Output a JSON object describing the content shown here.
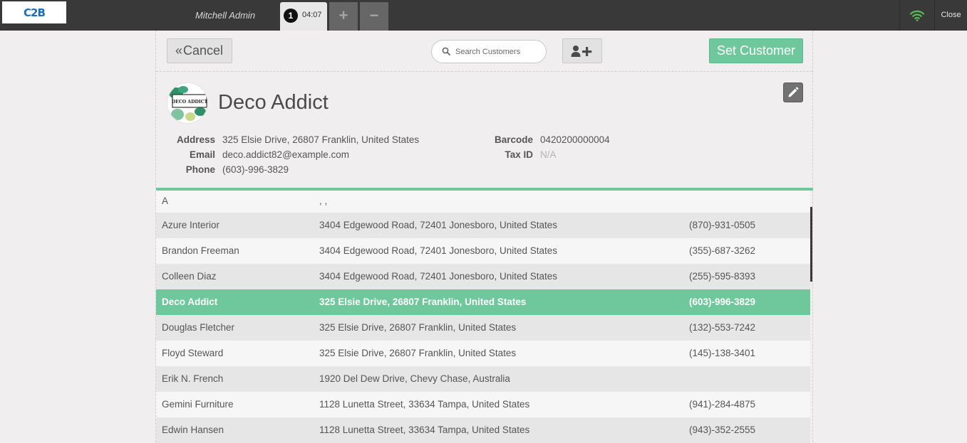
{
  "topbar": {
    "logo_text": "C2B",
    "user_name": "Mitchell Admin",
    "order_number": "1",
    "order_time": "04:07",
    "add_label": "+",
    "remove_label": "−",
    "close_label": "Close",
    "wifi_color": "#5cb85c"
  },
  "controls": {
    "cancel_chevron": "«",
    "cancel_label": "Cancel",
    "search_placeholder": "Search Customers",
    "set_customer_label": "Set Customer"
  },
  "customer": {
    "name": "Deco Addict",
    "logo_text": "DECO ADDICT",
    "address_label": "Address",
    "address": "325 Elsie Drive, 26807 Franklin, United States",
    "email_label": "Email",
    "email": "deco.addict82@example.com",
    "phone_label": "Phone",
    "phone": "(603)-996-3829",
    "barcode_label": "Barcode",
    "barcode": "0420200000004",
    "taxid_label": "Tax ID",
    "taxid": "N/A"
  },
  "list": {
    "rows": [
      {
        "name": "A",
        "address": ", ,",
        "phone": ""
      },
      {
        "name": "Azure Interior",
        "address": "3404 Edgewood Road, 72401 Jonesboro, United States",
        "phone": "(870)-931-0505"
      },
      {
        "name": "Brandon Freeman",
        "address": "3404 Edgewood Road, 72401 Jonesboro, United States",
        "phone": "(355)-687-3262"
      },
      {
        "name": "Colleen Diaz",
        "address": "3404 Edgewood Road, 72401 Jonesboro, United States",
        "phone": "(255)-595-8393"
      },
      {
        "name": "Deco Addict",
        "address": "325 Elsie Drive, 26807 Franklin, United States",
        "phone": "(603)-996-3829"
      },
      {
        "name": "Douglas Fletcher",
        "address": "325 Elsie Drive, 26807 Franklin, United States",
        "phone": "(132)-553-7242"
      },
      {
        "name": "Floyd Steward",
        "address": "325 Elsie Drive, 26807 Franklin, United States",
        "phone": "(145)-138-3401"
      },
      {
        "name": "Erik N. French",
        "address": "1920 Del Dew Drive, Chevy Chase, Australia",
        "phone": ""
      },
      {
        "name": "Gemini Furniture",
        "address": "1128 Lunetta Street, 33634 Tampa, United States",
        "phone": "(941)-284-4875"
      },
      {
        "name": "Edwin Hansen",
        "address": "1128 Lunetta Street, 33634 Tampa, United States",
        "phone": "(943)-352-2555"
      }
    ],
    "selected_index": 4,
    "accent_color": "#6ec89b"
  }
}
